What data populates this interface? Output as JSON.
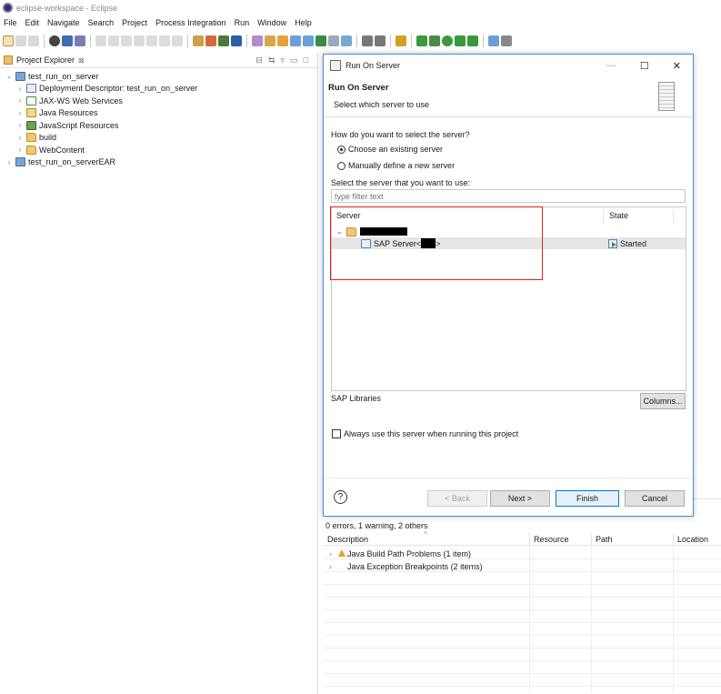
{
  "window": {
    "title": "eclipse-workspace - Eclipse"
  },
  "menu": [
    "File",
    "Edit",
    "Navigate",
    "Search",
    "Project",
    "Process Integration",
    "Run",
    "Window",
    "Help"
  ],
  "explorer": {
    "tab_label": "Project Explorer",
    "tab_close": "⊠",
    "tree": [
      {
        "label": "test_run_on_server",
        "level": 0,
        "chevron": "⌄",
        "icon": "proj"
      },
      {
        "label": "Deployment Descriptor: test_run_on_server",
        "level": 1,
        "chevron": "›",
        "icon": "dd"
      },
      {
        "label": "JAX-WS Web Services",
        "level": 1,
        "chevron": "›",
        "icon": "ws"
      },
      {
        "label": "Java Resources",
        "level": 1,
        "chevron": "›",
        "icon": "jr"
      },
      {
        "label": "JavaScript Resources",
        "level": 1,
        "chevron": "›",
        "icon": "js"
      },
      {
        "label": "build",
        "level": 1,
        "chevron": "›",
        "icon": "folder"
      },
      {
        "label": "WebContent",
        "level": 1,
        "chevron": "›",
        "icon": "folder"
      },
      {
        "label": "test_run_on_serverEAR",
        "level": 0,
        "chevron": "›",
        "icon": "proj"
      }
    ]
  },
  "problems": {
    "summary": "0 errors, 1 warning, 2 others",
    "sort_indicator": "^",
    "columns": [
      "Description",
      "Resource",
      "Path",
      "Location"
    ],
    "rows": [
      {
        "description": "Java Build Path Problems (1 item)",
        "icon": "warning-icon"
      },
      {
        "description": "Java Exception Breakpoints (2 items)",
        "icon": "none"
      }
    ]
  },
  "dialog": {
    "title": "Run On Server",
    "minimize": "—",
    "maximize": "☐",
    "close": "✕",
    "heading": "Run On Server",
    "subheading": "Select which server to use",
    "question": "How do you want to select the server?",
    "radio_existing": "Choose an existing server",
    "radio_manual": "Manually define a new server",
    "radio_selected": "existing",
    "filter_label": "Select the server that you want to use:",
    "filter_placeholder": "type filter text",
    "table": {
      "col_server": "Server",
      "col_state": "State",
      "group_chevron": "⌄",
      "server_name_prefix": "SAP Server<",
      "server_name_suffix": ">",
      "server_state": "Started"
    },
    "libraries_label": "SAP Libraries",
    "columns_button": "Columns...",
    "always_use_label": "Always use this server when running this project",
    "always_use_checked": false,
    "help": "?",
    "buttons": {
      "back": "< Back",
      "next": "Next >",
      "finish": "Finish",
      "cancel": "Cancel"
    }
  },
  "colors": {
    "highlight": "#e01e1e",
    "dialog_border": "#4a8fd6",
    "selection": "#e6e6e6"
  }
}
